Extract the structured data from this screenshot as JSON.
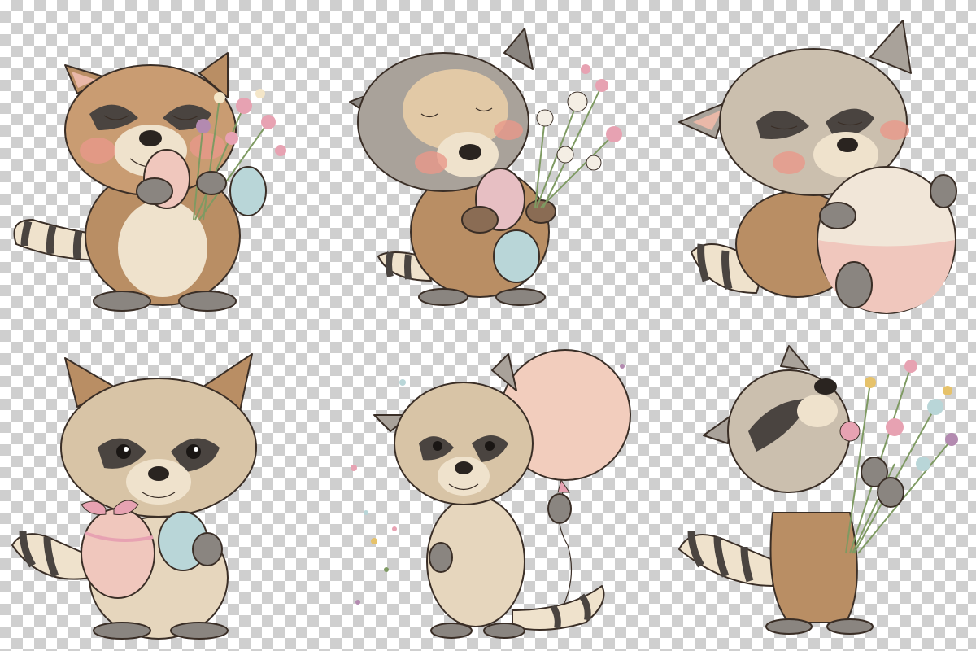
{
  "illustrations": [
    {
      "id": "raccoon-hugging-egg-with-bouquet"
    },
    {
      "id": "raccoon-holding-eggs-and-flowers"
    },
    {
      "id": "raccoon-sleeping-on-big-egg"
    },
    {
      "id": "raccoon-with-bow-egg"
    },
    {
      "id": "raccoon-with-balloon"
    },
    {
      "id": "raccoon-smelling-bouquet"
    }
  ],
  "colors": {
    "fur_tan": "#b98e64",
    "fur_cream": "#efe2cc",
    "fur_grey": "#8a8580",
    "mask_dark": "#4a4440",
    "blush": "#e9988a",
    "egg_pink": "#f0c7bd",
    "egg_blue": "#b9d6d8",
    "balloon_pink": "#f2cdbd",
    "leaf_green": "#7e9a62",
    "flower_pink": "#e7a2b2",
    "checker_light": "#ffffff",
    "checker_dark": "#cfcfcf"
  }
}
